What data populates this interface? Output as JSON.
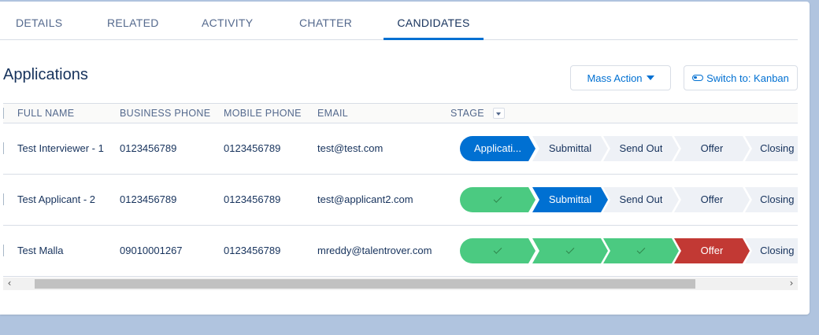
{
  "tabs": [
    {
      "label": "DETAILS"
    },
    {
      "label": "RELATED"
    },
    {
      "label": "ACTIVITY"
    },
    {
      "label": "CHATTER"
    },
    {
      "label": "CANDIDATES"
    }
  ],
  "active_tab": "CANDIDATES",
  "section": {
    "title": "Applications",
    "mass_action_label": "Mass Action",
    "switch_label": "Switch to: Kanban"
  },
  "columns": {
    "full_name": "FULL NAME",
    "business_phone": "BUSINESS PHONE",
    "mobile_phone": "MOBILE PHONE",
    "email": "EMAIL",
    "stage": "STAGE"
  },
  "rows": [
    {
      "full_name": "Test Interviewer - 1",
      "business_phone": "0123456789",
      "mobile_phone": "0123456789",
      "email": "test@test.com",
      "stages": [
        {
          "label": "Applicati...",
          "status": "current"
        },
        {
          "label": "Submittal",
          "status": "incomplete"
        },
        {
          "label": "Send Out",
          "status": "incomplete"
        },
        {
          "label": "Offer",
          "status": "incomplete"
        },
        {
          "label": "Closing ...",
          "status": "incomplete"
        }
      ]
    },
    {
      "full_name": "Test Applicant - 2",
      "business_phone": "0123456789",
      "mobile_phone": "0123456789",
      "email": "test@applicant2.com",
      "stages": [
        {
          "label": "",
          "status": "complete"
        },
        {
          "label": "Submittal",
          "status": "current"
        },
        {
          "label": "Send Out",
          "status": "incomplete"
        },
        {
          "label": "Offer",
          "status": "incomplete"
        },
        {
          "label": "Closing ...",
          "status": "incomplete"
        }
      ]
    },
    {
      "full_name": "Test Malla",
      "business_phone": "09010001267",
      "mobile_phone": "0123456789",
      "email": "mreddy@talentrover.com",
      "stages": [
        {
          "label": "",
          "status": "complete"
        },
        {
          "label": "",
          "status": "complete"
        },
        {
          "label": "",
          "status": "complete"
        },
        {
          "label": "Offer",
          "status": "lost"
        },
        {
          "label": "Closing ...",
          "status": "incomplete"
        }
      ]
    }
  ],
  "colors": {
    "brand": "#0070d2",
    "complete": "#4bca81",
    "lost": "#c23934",
    "incomplete": "#eef1f6"
  },
  "scroll": {
    "left_arrow": "‹",
    "right_arrow": "›"
  }
}
